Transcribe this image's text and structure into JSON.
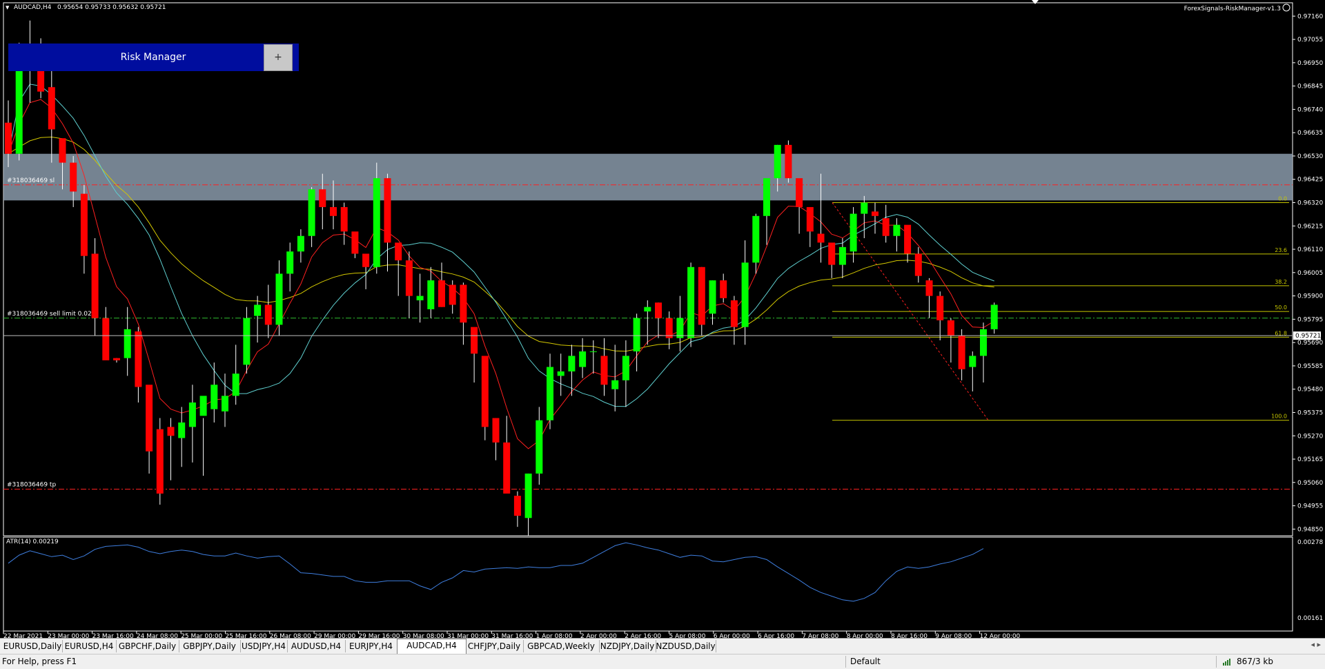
{
  "chart_header": {
    "symbol_tf": "AUDCAD,H4",
    "ohlc": "0.95654 0.95733 0.95632 0.95721",
    "ea_label": "ForexSignals-RiskManager-v1.3",
    "ea_icon": "smiley-icon"
  },
  "risk_manager": {
    "label": "Risk Manager",
    "plus": "+"
  },
  "order_labels": {
    "sl": "#318036469 sl",
    "sell_limit": "#318036469 sell limit 0.02",
    "tp": "#318036469 tp"
  },
  "fib_labels": [
    "0.0",
    "23.6",
    "38.2",
    "50.0",
    "61.8",
    "100.0"
  ],
  "atr": {
    "label": "ATR(14) 0.00219",
    "scale_top": "0.00278",
    "scale_bottom": "0.00161"
  },
  "price_axis": {
    "ticks": [
      "0.97160",
      "0.97055",
      "0.96950",
      "0.96845",
      "0.96740",
      "0.96635",
      "0.96530",
      "0.96425",
      "0.96320",
      "0.96215",
      "0.96110",
      "0.96005",
      "0.95900",
      "0.95795",
      "0.95690",
      "0.95585",
      "0.95480",
      "0.95375",
      "0.95270",
      "0.95165",
      "0.95060",
      "0.94955",
      "0.94850"
    ],
    "current_price": "0.95721"
  },
  "time_axis": [
    "22 Mar 2021",
    "23 Mar 00:00",
    "23 Mar 16:00",
    "24 Mar 08:00",
    "25 Mar 00:00",
    "25 Mar 16:00",
    "26 Mar 08:00",
    "29 Mar 00:00",
    "29 Mar 16:00",
    "30 Mar 08:00",
    "31 Mar 00:00",
    "31 Mar 16:00",
    "1 Apr 08:00",
    "2 Apr 00:00",
    "2 Apr 16:00",
    "5 Apr 08:00",
    "6 Apr 00:00",
    "6 Apr 16:00",
    "7 Apr 08:00",
    "8 Apr 00:00",
    "8 Apr 16:00",
    "9 Apr 08:00",
    "12 Apr 00:00"
  ],
  "tabs": [
    "EURUSD,Daily",
    "EURUSD,H4",
    "GBPCHF,Daily",
    "GBPJPY,Daily",
    "USDJPY,H4",
    "AUDUSD,H4",
    "EURJPY,H4",
    "AUDCAD,H4",
    "CHFJPY,Daily",
    "GBPCAD,Weekly",
    "NZDJPY,Daily",
    "NZDUSD,Daily"
  ],
  "active_tab": "AUDCAD,H4",
  "status": {
    "help": "For Help, press F1",
    "profile": "Default",
    "traffic": "867/3 kb"
  },
  "colors": {
    "bull": "#00ff00",
    "bear": "#ff0000",
    "zone": "#8a9aaa",
    "fib": "#c8c800",
    "ma_red": "#ff2020",
    "ma_cyan": "#5fd0d0",
    "ma_yellow": "#d4c800",
    "atr": "#3f7fe0"
  },
  "chart_data": {
    "type": "candlestick",
    "symbol": "AUDCAD",
    "timeframe": "H4",
    "ylim": [
      0.9482,
      0.9722
    ],
    "candles": [
      [
        0.9668,
        0.9678,
        0.9648,
        0.9654
      ],
      [
        0.9654,
        0.9704,
        0.9651,
        0.9701
      ],
      [
        0.97,
        0.9714,
        0.9677,
        0.9701
      ],
      [
        0.9701,
        0.9706,
        0.9679,
        0.9682
      ],
      [
        0.9684,
        0.9695,
        0.965,
        0.9665
      ],
      [
        0.9661,
        0.966,
        0.9638,
        0.965
      ],
      [
        0.965,
        0.9653,
        0.963,
        0.9637
      ],
      [
        0.9636,
        0.964,
        0.96,
        0.9608
      ],
      [
        0.9609,
        0.9616,
        0.9572,
        0.958
      ],
      [
        0.958,
        0.9585,
        0.9562,
        0.9561
      ],
      [
        0.9562,
        0.9562,
        0.956,
        0.9561
      ],
      [
        0.9562,
        0.9585,
        0.9554,
        0.9575
      ],
      [
        0.9574,
        0.9576,
        0.9542,
        0.9549
      ],
      [
        0.955,
        0.9545,
        0.951,
        0.952
      ],
      [
        0.953,
        0.9535,
        0.9496,
        0.9501
      ],
      [
        0.9531,
        0.9535,
        0.9507,
        0.9527
      ],
      [
        0.9526,
        0.954,
        0.9513,
        0.9533
      ],
      [
        0.9531,
        0.955,
        0.9515,
        0.9542
      ],
      [
        0.9536,
        0.9535,
        0.9509,
        0.9545
      ],
      [
        0.9539,
        0.956,
        0.9533,
        0.955
      ],
      [
        0.9538,
        0.9555,
        0.9531,
        0.9545
      ],
      [
        0.9545,
        0.9568,
        0.9541,
        0.9555
      ],
      [
        0.9559,
        0.9585,
        0.9555,
        0.958
      ],
      [
        0.9581,
        0.959,
        0.9569,
        0.9586
      ],
      [
        0.9586,
        0.9595,
        0.9571,
        0.9577
      ],
      [
        0.9577,
        0.9606,
        0.9572,
        0.96
      ],
      [
        0.96,
        0.9614,
        0.9592,
        0.961
      ],
      [
        0.961,
        0.962,
        0.9605,
        0.9617
      ],
      [
        0.9617,
        0.9639,
        0.9612,
        0.9638
      ],
      [
        0.9638,
        0.9645,
        0.962,
        0.963
      ],
      [
        0.963,
        0.9642,
        0.962,
        0.9626
      ],
      [
        0.963,
        0.9632,
        0.9613,
        0.9619
      ],
      [
        0.9619,
        0.9617,
        0.9607,
        0.9609
      ],
      [
        0.9609,
        0.9606,
        0.9593,
        0.9603
      ],
      [
        0.9603,
        0.965,
        0.96,
        0.9643
      ],
      [
        0.9643,
        0.9645,
        0.9601,
        0.9614
      ],
      [
        0.9614,
        0.9612,
        0.959,
        0.9606
      ],
      [
        0.9606,
        0.961,
        0.958,
        0.959
      ],
      [
        0.9588,
        0.96,
        0.9578,
        0.959
      ],
      [
        0.9584,
        0.9603,
        0.958,
        0.9597
      ],
      [
        0.9597,
        0.9605,
        0.9585,
        0.9585
      ],
      [
        0.9595,
        0.9597,
        0.9582,
        0.9586
      ],
      [
        0.9595,
        0.9596,
        0.9568,
        0.9578
      ],
      [
        0.9576,
        0.9575,
        0.9551,
        0.9564
      ],
      [
        0.9563,
        0.9557,
        0.9525,
        0.9531
      ],
      [
        0.9535,
        0.9535,
        0.9516,
        0.9524
      ],
      [
        0.9524,
        0.9536,
        0.9508,
        0.9501
      ],
      [
        0.95,
        0.9502,
        0.9486,
        0.9491
      ],
      [
        0.949,
        0.951,
        0.9482,
        0.951
      ],
      [
        0.951,
        0.954,
        0.9505,
        0.9534
      ],
      [
        0.9534,
        0.9564,
        0.953,
        0.9558
      ],
      [
        0.9554,
        0.9564,
        0.9545,
        0.9556
      ],
      [
        0.9556,
        0.9568,
        0.9545,
        0.9563
      ],
      [
        0.9558,
        0.9571,
        0.9553,
        0.9565
      ],
      [
        0.9565,
        0.957,
        0.9555,
        0.9565
      ],
      [
        0.9563,
        0.9571,
        0.9545,
        0.955
      ],
      [
        0.9548,
        0.9568,
        0.9538,
        0.9552
      ],
      [
        0.9552,
        0.957,
        0.954,
        0.9563
      ],
      [
        0.9565,
        0.9582,
        0.9556,
        0.958
      ],
      [
        0.9583,
        0.9588,
        0.9568,
        0.9585
      ],
      [
        0.9587,
        0.9587,
        0.9571,
        0.958
      ],
      [
        0.958,
        0.9583,
        0.9566,
        0.9571
      ],
      [
        0.9571,
        0.959,
        0.9565,
        0.958
      ],
      [
        0.9571,
        0.9605,
        0.9567,
        0.9603
      ],
      [
        0.9603,
        0.9603,
        0.9572,
        0.9577
      ],
      [
        0.9582,
        0.9597,
        0.9577,
        0.9597
      ],
      [
        0.9597,
        0.96,
        0.9587,
        0.9589
      ],
      [
        0.9588,
        0.959,
        0.9568,
        0.9576
      ],
      [
        0.9576,
        0.9615,
        0.9568,
        0.9605
      ],
      [
        0.9605,
        0.9627,
        0.96,
        0.9626
      ],
      [
        0.9626,
        0.9636,
        0.9613,
        0.9643
      ],
      [
        0.9643,
        0.9658,
        0.9637,
        0.9658
      ],
      [
        0.9658,
        0.966,
        0.9641,
        0.9643
      ],
      [
        0.9643,
        0.9642,
        0.9618,
        0.963
      ],
      [
        0.963,
        0.9628,
        0.9612,
        0.9619
      ],
      [
        0.9618,
        0.9645,
        0.9605,
        0.9614
      ],
      [
        0.9614,
        0.9613,
        0.9598,
        0.9604
      ],
      [
        0.9604,
        0.9616,
        0.9598,
        0.9612
      ],
      [
        0.961,
        0.963,
        0.9605,
        0.9627
      ],
      [
        0.9627,
        0.9635,
        0.9616,
        0.9632
      ],
      [
        0.9628,
        0.9632,
        0.9618,
        0.9626
      ],
      [
        0.9625,
        0.9631,
        0.9614,
        0.9617
      ],
      [
        0.9617,
        0.9625,
        0.961,
        0.9622
      ],
      [
        0.9622,
        0.9617,
        0.9605,
        0.9609
      ],
      [
        0.9609,
        0.9612,
        0.9596,
        0.9599
      ],
      [
        0.9597,
        0.9598,
        0.958,
        0.959
      ],
      [
        0.959,
        0.9592,
        0.957,
        0.9579
      ],
      [
        0.9579,
        0.958,
        0.956,
        0.9572
      ],
      [
        0.9572,
        0.9575,
        0.9552,
        0.9557
      ],
      [
        0.9558,
        0.9565,
        0.9547,
        0.9563
      ],
      [
        0.9563,
        0.9578,
        0.9551,
        0.9575
      ],
      [
        0.9575,
        0.9587,
        0.9573,
        0.9586
      ]
    ],
    "fibonacci": {
      "high": 0.9632,
      "low": 0.9534,
      "levels": [
        0.0,
        23.6,
        38.2,
        50.0,
        61.8,
        100.0
      ]
    },
    "zone": {
      "top": 0.9654,
      "bottom": 0.9633
    },
    "orders": {
      "sl": 0.964,
      "sell_limit": 0.958,
      "tp": 0.9503
    },
    "atr_values": [
      0.00248,
      0.00259,
      0.00265,
      0.00261,
      0.00257,
      0.00259,
      0.00253,
      0.00258,
      0.00267,
      0.00271,
      0.00272,
      0.00273,
      0.0027,
      0.00264,
      0.00261,
      0.00264,
      0.00266,
      0.00264,
      0.0026,
      0.00258,
      0.00258,
      0.00262,
      0.00258,
      0.00255,
      0.00257,
      0.00258,
      0.00247,
      0.00235,
      0.00234,
      0.00232,
      0.0023,
      0.0023,
      0.00224,
      0.00222,
      0.00222,
      0.00224,
      0.00224,
      0.00224,
      0.00217,
      0.00212,
      0.00222,
      0.00228,
      0.00238,
      0.00236,
      0.0024,
      0.00241,
      0.00242,
      0.00241,
      0.00243,
      0.00242,
      0.00242,
      0.00245,
      0.00245,
      0.00248,
      0.00256,
      0.00264,
      0.00272,
      0.00276,
      0.00273,
      0.00269,
      0.00266,
      0.00261,
      0.00256,
      0.00259,
      0.00258,
      0.00251,
      0.0025,
      0.00253,
      0.00256,
      0.00257,
      0.00253,
      0.00243,
      0.00234,
      0.00225,
      0.00215,
      0.00208,
      0.00203,
      0.00198,
      0.00196,
      0.002,
      0.00208,
      0.00224,
      0.00237,
      0.00243,
      0.00241,
      0.00243,
      0.00247,
      0.0025,
      0.00255,
      0.0026,
      0.00268
    ]
  }
}
